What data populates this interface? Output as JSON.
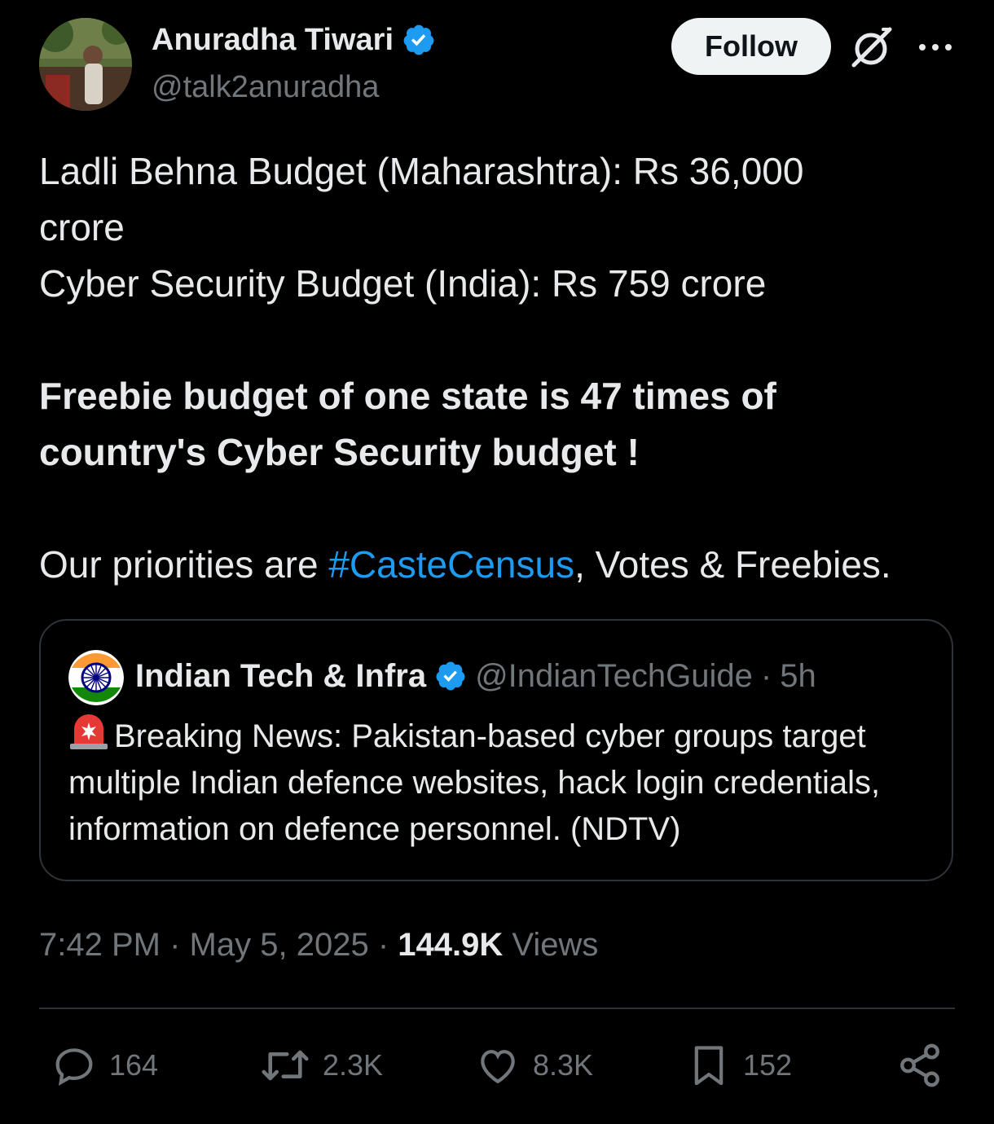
{
  "author": {
    "display_name": "Anuradha Tiwari",
    "handle": "@talk2anuradha",
    "verified": true
  },
  "header": {
    "follow_label": "Follow",
    "icons": [
      "grok-icon",
      "more-icon"
    ]
  },
  "tweet": {
    "line1": "Ladli Behna Budget (Maharashtra): Rs 36,000 crore",
    "line2": "Cyber Security Budget (India): Rs 759 crore",
    "bold_text": "Freebie budget of one state is 47 times of country's Cyber Security budget !",
    "priorities_prefix": "Our priorities are ",
    "hashtag": "#CasteCensus",
    "priorities_suffix": ", Votes & Freebies."
  },
  "quote": {
    "name": "Indian Tech & Infra",
    "handle": "@IndianTechGuide",
    "separator": "·",
    "age": "5h",
    "text": "Breaking News: Pakistan-based cyber groups target multiple Indian defence websites, hack login credentials, information on defence personnel. (NDTV)"
  },
  "meta": {
    "time": "7:42 PM",
    "dot": "·",
    "date": "May 5, 2025",
    "views_count": "144.9K",
    "views_label": "Views"
  },
  "actions": {
    "replies": "164",
    "reposts": "2.3K",
    "likes": "8.3K",
    "bookmarks": "152"
  },
  "colors": {
    "background": "#000000",
    "text": "#e7e9ea",
    "muted": "#71767b",
    "accent": "#1d9bf0",
    "border": "#2f3336"
  }
}
